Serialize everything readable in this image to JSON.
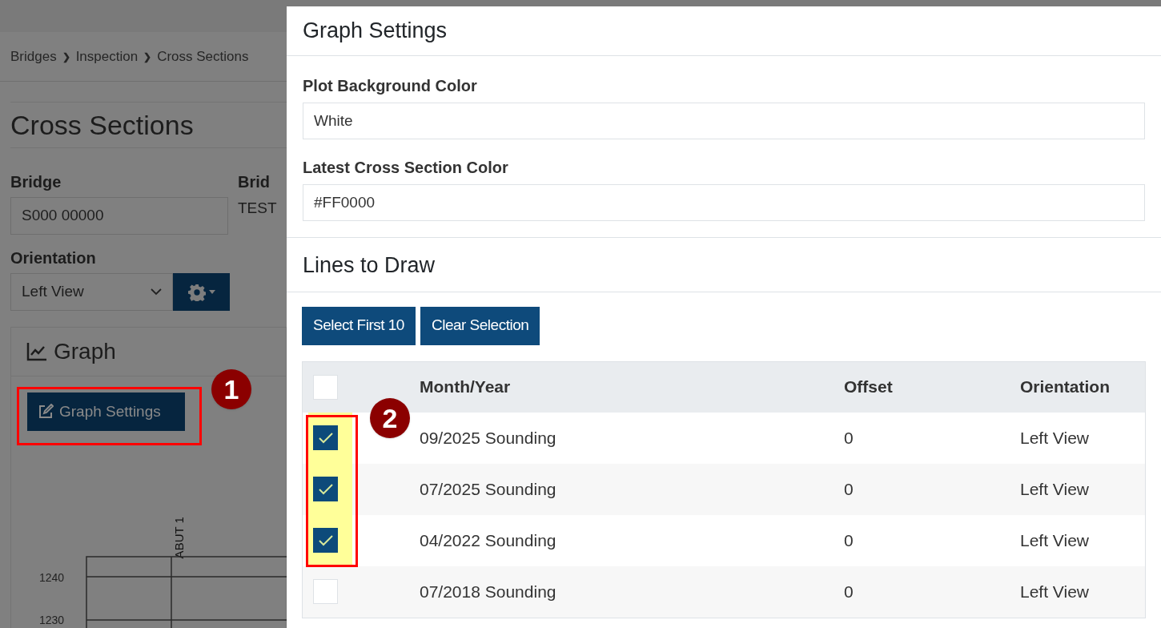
{
  "background_page": {
    "breadcrumb": [
      "Bridges",
      "Inspection",
      "Cross Sections"
    ],
    "breadcrumb_separator": "❯",
    "heading": "Cross Sections",
    "bridge": {
      "label": "Bridge",
      "value": "S000 00000"
    },
    "bridge_name": {
      "label": "Brid",
      "value": "TEST"
    },
    "orientation": {
      "label": "Orientation",
      "value": "Left View"
    },
    "graph": {
      "title": "Graph",
      "settings_button": "Graph Settings",
      "marker_label": "ABUT 1",
      "tick_labels": [
        "1240",
        "1230"
      ]
    }
  },
  "drawer": {
    "title": "Graph Settings",
    "fields": [
      {
        "label": "Plot Background Color",
        "value": "White"
      },
      {
        "label": "Latest Cross Section Color",
        "value": "#FF0000"
      }
    ],
    "section_title": "Lines to Draw",
    "buttons": [
      "Select First 10",
      "Clear Selection"
    ],
    "table": {
      "select_all_checked": false,
      "columns": [
        "Month/Year",
        "Offset",
        "Orientation"
      ],
      "rows": [
        {
          "checked": true,
          "cells": [
            "09/2025 Sounding",
            "0",
            "Left View"
          ]
        },
        {
          "checked": true,
          "cells": [
            "07/2025 Sounding",
            "0",
            "Left View"
          ]
        },
        {
          "checked": true,
          "cells": [
            "04/2022 Sounding",
            "0",
            "Left View"
          ]
        },
        {
          "checked": false,
          "cells": [
            "07/2018 Sounding",
            "0",
            "Left View"
          ]
        }
      ]
    }
  },
  "callouts": [
    "1",
    "2"
  ]
}
